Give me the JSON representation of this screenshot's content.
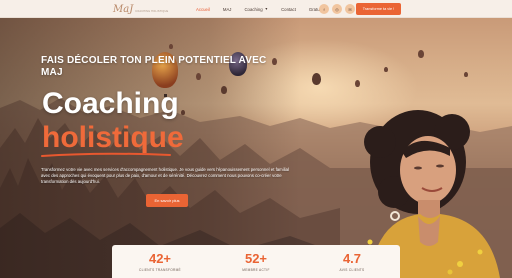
{
  "header": {
    "logo_text": "MaJ",
    "logo_subtext": "COACHING HOLISTIQUE",
    "nav": [
      {
        "label": "Accueil",
        "active": true,
        "dropdown": false
      },
      {
        "label": "MAJ",
        "active": false,
        "dropdown": false
      },
      {
        "label": "Coaching",
        "active": false,
        "dropdown": true
      },
      {
        "label": "Contact",
        "active": false,
        "dropdown": false
      },
      {
        "label": "Gratuit",
        "active": false,
        "dropdown": true
      }
    ],
    "socials": [
      {
        "icon": "facebook-icon",
        "glyph": "f"
      },
      {
        "icon": "instagram-icon",
        "glyph": "◎"
      },
      {
        "icon": "email-icon",
        "glyph": "✉"
      }
    ],
    "cta_label": "Transforme ta vie !"
  },
  "hero": {
    "title": "FAIS DÉCOLER TON PLEIN POTENTIEL AVEC MAJ",
    "big": "Coaching",
    "big_accent": "holistique",
    "description": "Transformez votre vie avec mes services d'accompagnement holistique. Je vous guide vers l'épanouissement personnel et familial avec des approches qui évoquent pour plus de paix, d'amour et de sérénité. Découvrez comment nous pouvons co-créer votre transformation dès aujourd'hui.",
    "cta_label": "En savoir plus"
  },
  "stats": [
    {
      "value": "42+",
      "label": "CLIENTS TRANSFORMÉ"
    },
    {
      "value": "52+",
      "label": "MEMBRE ACTIF"
    },
    {
      "value": "4.7",
      "label": "AVIS CLIENTS"
    }
  ],
  "colors": {
    "accent": "#ea6434",
    "header_bg": "#f7efe8",
    "hero_accent_text": "#ef6a3a"
  }
}
